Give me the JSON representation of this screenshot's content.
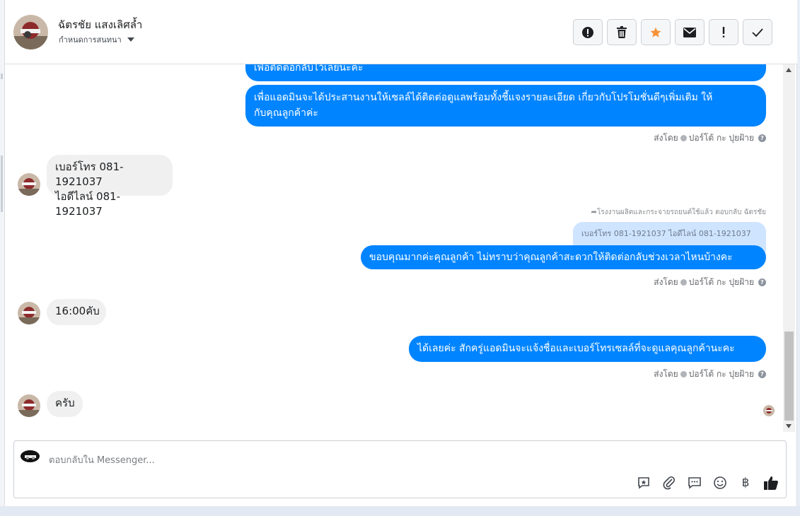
{
  "header": {
    "contact_name": "ฉัตรชัย แสงเลิศล้ำ",
    "subtitle": "กำหนดการสนทนา",
    "actions": [
      {
        "icon": "alert-circle-icon",
        "label": "!"
      },
      {
        "icon": "trash-icon",
        "label": "delete"
      },
      {
        "icon": "star-icon",
        "label": "star"
      },
      {
        "icon": "envelope-icon",
        "label": "mark-unread"
      },
      {
        "icon": "exclamation-icon",
        "label": "!"
      },
      {
        "icon": "check-icon",
        "label": "done"
      }
    ]
  },
  "messages": {
    "m1": "เพื่อติดต่อกลับไว้เลยนะคะ",
    "m2_line1": "เพื่อแอดมินจะได้ประสานงานให้เซลล์ได้ติดต่อดูแลพร้อมทั้งชี้แจงรายละเอียด เกี่ยวกับโปรโมชั่นดีๆเพิ่มเติม ให้",
    "m2_line2": "กับคุณลูกค้าค่ะ",
    "meta_sent_by": "ส่งโดย",
    "meta_sender": "ปอร์โต้ กะ ปุยฝ้าย",
    "in1_line1": "เบอร์โทร 081-1921037",
    "in1_line2": "ไอดีไลน์ 081-1921037",
    "reply_note": "โรงงานผลิตและกระจายรถยนต์ใช้แล้ว ตอบกลับ ฉัตรชัย",
    "quote": "เบอร์โทร 081-1921037 ไอดีไลน์ 081-1921037",
    "m3": "ขอบคุณมากค่ะคุณลูกค้า ไม่ทราบว่าคุณลูกค้าสะดวกให้ติดต่อกลับช่วงเวลาไหนบ้างคะ",
    "in2": "16:00คับ",
    "m4": "ได้เลยค่ะ สักครู่แอดมินจะแจ้งชื่อและเบอร์โทรเซลล์ที่จะดูแลคุณลูกค้านะคะ",
    "in3": "ครับ"
  },
  "composer": {
    "placeholder": "ตอบกลับใน Messenger...",
    "tools": [
      "quick-reply-icon",
      "paperclip-icon",
      "saved-reply-icon",
      "emoji-icon",
      "baht-icon",
      "thumbs-up-icon"
    ],
    "baht_symbol": "฿"
  },
  "colors": {
    "outgoing": "#0084ff",
    "incoming": "#f0f0f0",
    "quote_bg": "#cfe4ff",
    "star": "#f7923a"
  }
}
